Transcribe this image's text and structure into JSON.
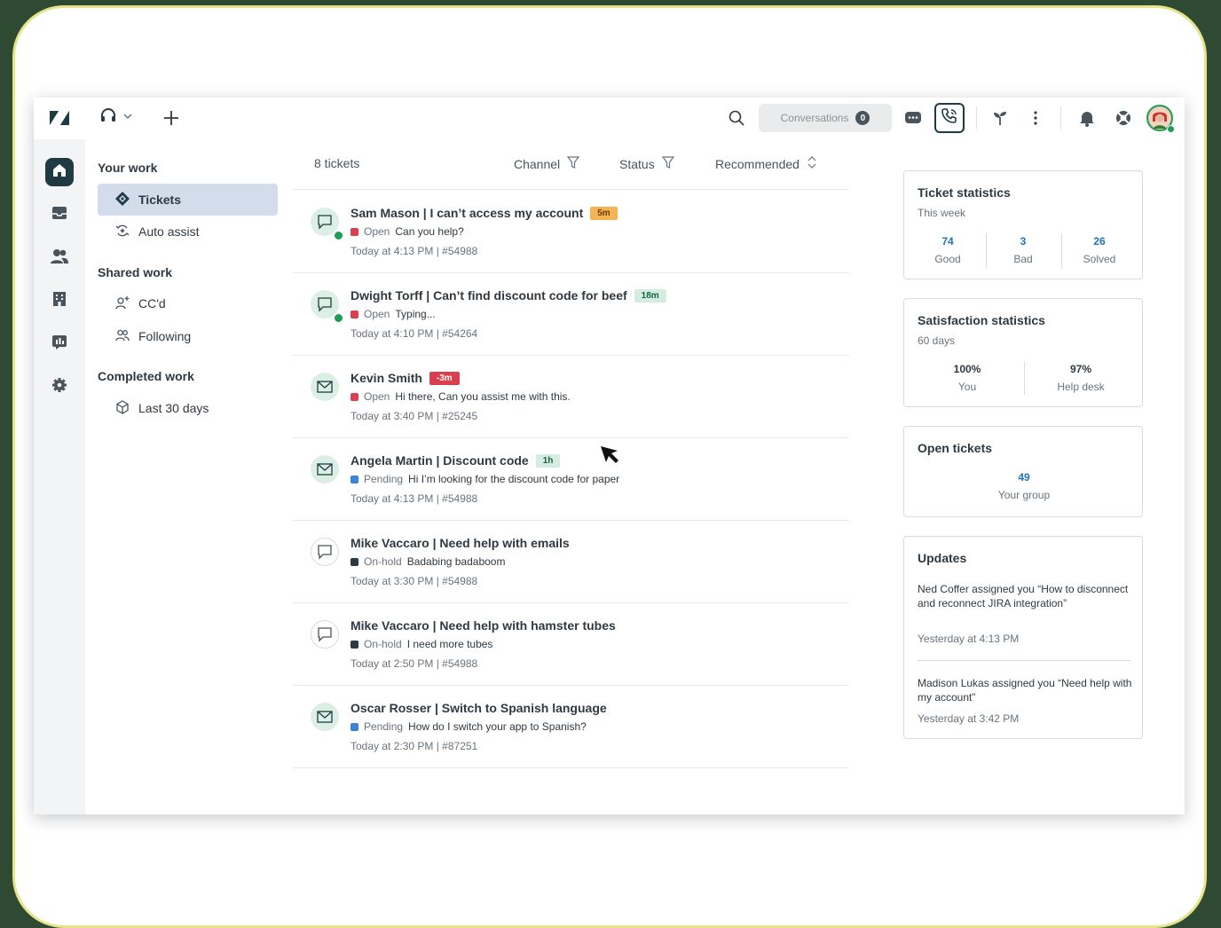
{
  "topbar": {
    "conversations_label": "Conversations",
    "conversations_count": "0"
  },
  "nav": {
    "your_work": "Your work",
    "tickets": "Tickets",
    "auto_assist": "Auto assist",
    "shared_work": "Shared work",
    "ccd": "CC'd",
    "following": "Following",
    "completed_work": "Completed work",
    "last_30_days": "Last 30 days"
  },
  "list": {
    "count_label": "8 tickets",
    "channel_label": "Channel",
    "status_label": "Status",
    "sort_label": "Recommended",
    "tickets": [
      {
        "title": "Sam Mason | I can’t access my account",
        "badge": "5m",
        "status": "Open",
        "message": "Can you help?",
        "meta": "Today at 4:13 PM | #54988"
      },
      {
        "title": "Dwight Torff | Can’t find discount code for beef",
        "badge": "18m",
        "status": "Open",
        "message": "Typing...",
        "meta": "Today at 4:10 PM | #54264"
      },
      {
        "title": "Kevin Smith",
        "badge": "-3m",
        "status": "Open",
        "message": "Hi there, Can you assist me with this.",
        "meta": "Today at 3:40 PM | #25245"
      },
      {
        "title": "Angela Martin | Discount code",
        "badge": "1h",
        "status": "Pending",
        "message": "Hi I’m looking for the discount code for paper",
        "meta": "Today at 4:13 PM | #54988"
      },
      {
        "title": "Mike Vaccaro | Need help with emails",
        "status": "On-hold",
        "message": "Badabing badaboom",
        "meta": "Today at 3:30 PM | #54988"
      },
      {
        "title": "Mike Vaccaro | Need help with hamster tubes",
        "status": "On-hold",
        "message": "I need more tubes",
        "meta": "Today at 2:50 PM | #54988"
      },
      {
        "title": "Oscar Rosser | Switch to Spanish language",
        "status": "Pending",
        "message": "How do I switch your app to Spanish?",
        "meta": "Today at 2:30 PM | #87251"
      }
    ]
  },
  "ticket_stats": {
    "title": "Ticket statistics",
    "period": "This week",
    "good_value": "74",
    "good_label": "Good",
    "bad_value": "3",
    "bad_label": "Bad",
    "solved_value": "26",
    "solved_label": "Solved"
  },
  "satisfaction": {
    "title": "Satisfaction statistics",
    "period": "60 days",
    "you_value": "100%",
    "you_label": "You",
    "helpdesk_value": "97%",
    "helpdesk_label": "Help desk"
  },
  "open_tickets": {
    "title": "Open tickets",
    "value": "49",
    "label": "Your group"
  },
  "updates": {
    "title": "Updates",
    "items": [
      {
        "text": "Ned Coffer assigned you “How to disconnect and reconnect JIRA integration”",
        "time": "Yesterday at 4:13 PM"
      },
      {
        "text": "Madison Lukas assigned you “Need help with my account”",
        "time": "Yesterday at 3:42 PM"
      }
    ]
  },
  "colors": {
    "open": "#d93f4c",
    "pending": "#3b82d8",
    "onhold": "#2f3941",
    "accent_link": "#1f73b7"
  },
  "icons": {
    "logo": "zendesk-logo-icon",
    "avatar_green": "chat-bubble-icon",
    "email": "envelope-icon"
  }
}
